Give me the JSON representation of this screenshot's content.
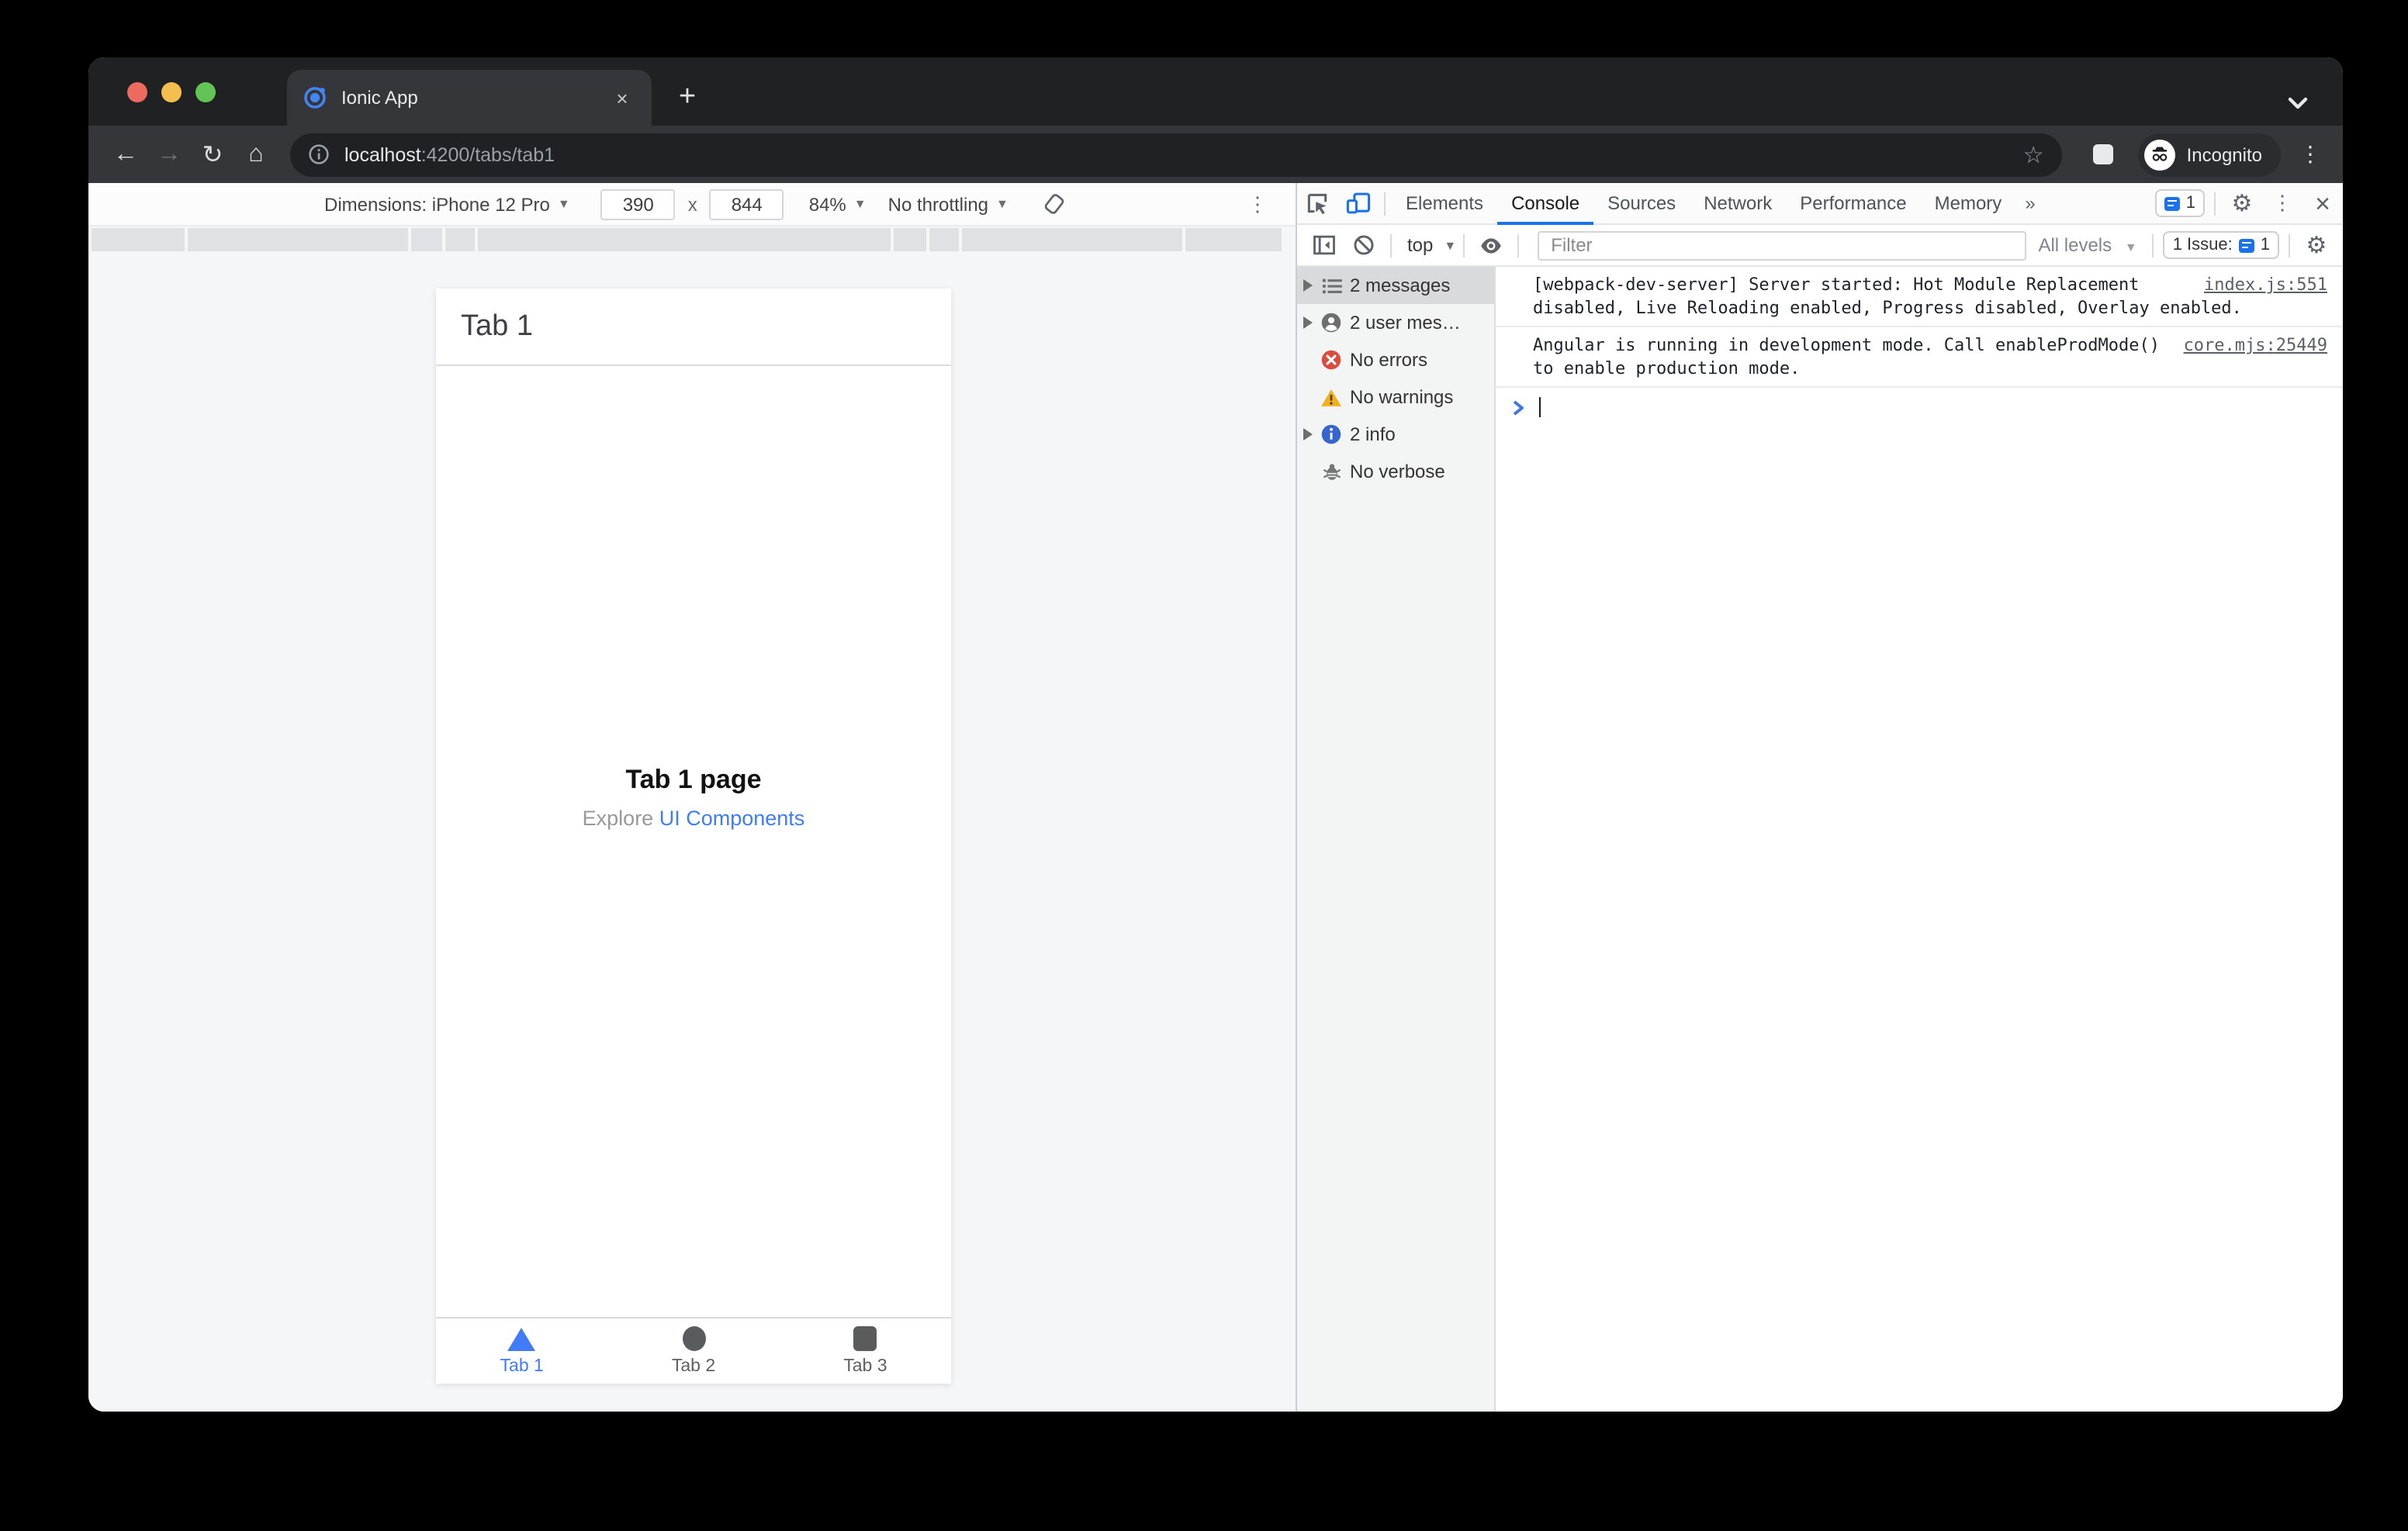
{
  "colors": {
    "accent_blue": "#1a73e8",
    "ionic_blue": "#3f7cf6",
    "error_red": "#dd4b3e",
    "warning_yellow": "#f2b11c",
    "info_blue": "#3665d0"
  },
  "browser": {
    "tab_title": "Ionic App",
    "new_tab_plus": "+",
    "url_host": "localhost",
    "url_rest": ":4200/tabs/tab1",
    "incognito_label": "Incognito",
    "close_tab": "×"
  },
  "emulation": {
    "dimensions_label": "Dimensions:",
    "device": "iPhone 12 Pro",
    "width_value": "390",
    "x_separator": "x",
    "height_value": "844",
    "zoom_value": "84%",
    "throttling": "No throttling"
  },
  "app": {
    "header_title": "Tab 1",
    "heading": "Tab 1 page",
    "explore_prefix": "Explore ",
    "explore_link": "UI Components",
    "tabs": [
      {
        "label": "Tab 1",
        "icon": "triangle",
        "active": true
      },
      {
        "label": "Tab 2",
        "icon": "circle",
        "active": false
      },
      {
        "label": "Tab 3",
        "icon": "square",
        "active": false
      }
    ]
  },
  "devtools": {
    "tabs": [
      "Elements",
      "Console",
      "Sources",
      "Network",
      "Performance",
      "Memory"
    ],
    "active_tab": "Console",
    "more_tabs": "»",
    "header_issue_count": "1",
    "context_selector": "top",
    "filter_placeholder": "Filter",
    "levels_label": "All levels",
    "issues_label": "1 Issue:",
    "issues_count": "1",
    "sidebar_items": [
      {
        "label": "2 messages",
        "icon": "list"
      },
      {
        "label": "2 user mes…",
        "icon": "user"
      },
      {
        "label": "No errors",
        "icon": "error"
      },
      {
        "label": "No warnings",
        "icon": "warning"
      },
      {
        "label": "2 info",
        "icon": "info"
      },
      {
        "label": "No verbose",
        "icon": "verbose"
      }
    ],
    "messages": [
      {
        "text": "[webpack-dev-server] Server started: Hot Module Replacement disabled, Live Reloading enabled, Progress disabled, Overlay enabled.",
        "source": "index.js:551"
      },
      {
        "text": "Angular is running in development mode. Call enableProdMode() to enable production mode.",
        "source": "core.mjs:25449"
      }
    ]
  }
}
